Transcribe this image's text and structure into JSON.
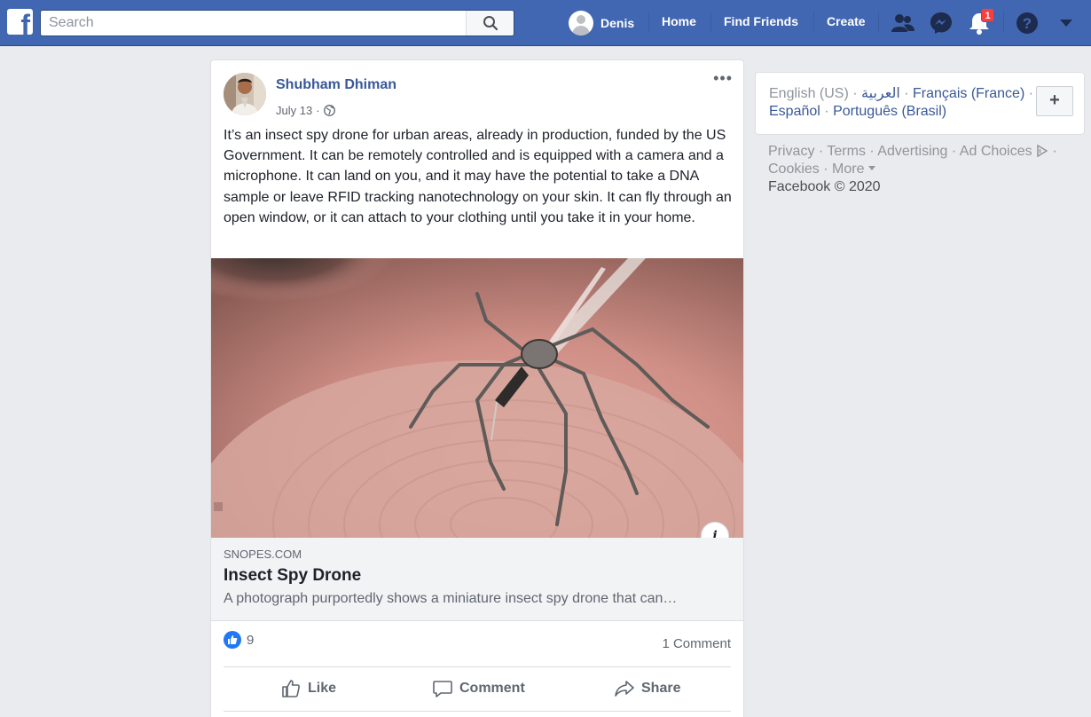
{
  "topbar": {
    "logo_letter": "f",
    "search_placeholder": "Search",
    "user_name": "Denis",
    "nav": [
      "Home",
      "Find Friends",
      "Create"
    ],
    "notification_count": "1",
    "bg_color": "#4267b2"
  },
  "post": {
    "author": "Shubham Dhiman",
    "date": "July 13",
    "privacy_icon": "globe-icon",
    "more": "•••",
    "text": "It’s an insect spy drone for urban areas, already in production, funded by the US Government. It can be remotely controlled and is equipped with a camera and a microphone. It can land on you, and it may have the potential to take a DNA sample or leave RFID tracking nanotechnology on your skin. It can fly through an open window, or it can attach to your clothing until you take it in your home.",
    "link": {
      "domain": "SNOPES.COM",
      "title": "Insect Spy Drone",
      "description": "A photograph purportedly shows a miniature insect spy drone that can…",
      "info_label": "i"
    },
    "reaction_count": "9",
    "comment_count": "1 Comment",
    "actions": [
      "Like",
      "Comment",
      "Share"
    ]
  },
  "sidebar": {
    "languages": {
      "current": "English (US)",
      "others": [
        "العربية",
        "Français (France)",
        "Español",
        "Português (Brasil)"
      ],
      "add": "+"
    },
    "footer": {
      "links": [
        "Privacy",
        "Terms",
        "Advertising",
        "Ad Choices",
        "Cookies",
        "More"
      ],
      "copyright": "Facebook © 2020"
    }
  }
}
